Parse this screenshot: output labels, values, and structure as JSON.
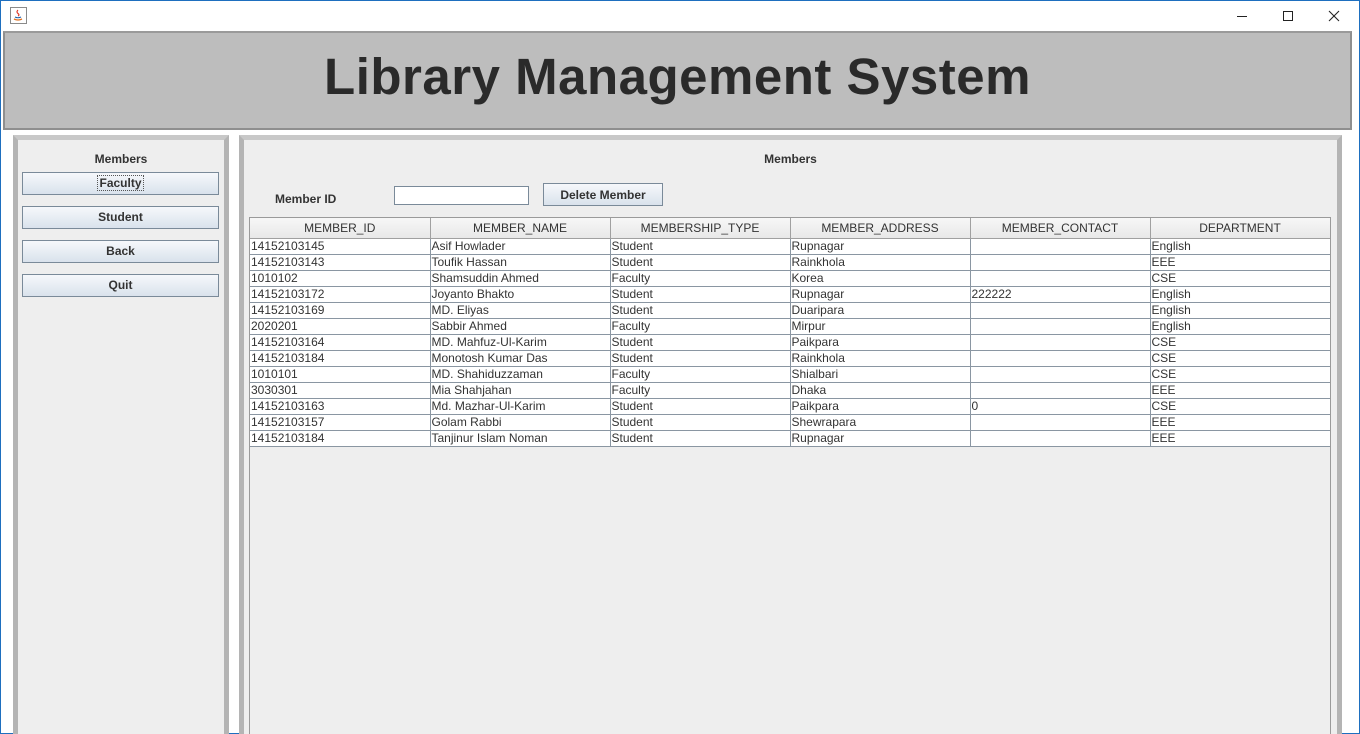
{
  "window": {
    "controls": {
      "minimize": "minimize-icon",
      "maximize": "maximize-icon",
      "close": "close-icon"
    },
    "app_icon": "java-icon"
  },
  "header": {
    "title": "Library Management System"
  },
  "left_panel": {
    "title": "Members",
    "buttons": [
      "Faculty",
      "Student",
      "Back",
      "Quit"
    ]
  },
  "main_panel": {
    "title": "Members",
    "member_id_label": "Member ID",
    "member_id_value": "",
    "delete_button": "Delete Member",
    "table": {
      "columns": [
        "MEMBER_ID",
        "MEMBER_NAME",
        "MEMBERSHIP_TYPE",
        "MEMBER_ADDRESS",
        "MEMBER_CONTACT",
        "DEPARTMENT"
      ],
      "rows": [
        [
          "14152103145",
          "Asif Howlader",
          "Student",
          "Rupnagar",
          "",
          "English"
        ],
        [
          "14152103143",
          "Toufik Hassan",
          "Student",
          "Rainkhola",
          "",
          "EEE"
        ],
        [
          "1010102",
          "Shamsuddin Ahmed",
          "Faculty",
          "Korea",
          "",
          "CSE"
        ],
        [
          "14152103172",
          "Joyanto Bhakto",
          "Student",
          "Rupnagar",
          "222222",
          "English"
        ],
        [
          "14152103169",
          "MD. Eliyas",
          "Student",
          "Duaripara",
          "",
          "English"
        ],
        [
          "2020201",
          "Sabbir Ahmed",
          "Faculty",
          "Mirpur",
          "",
          "English"
        ],
        [
          "14152103164",
          "MD. Mahfuz-Ul-Karim",
          "Student",
          "Paikpara",
          "",
          "CSE"
        ],
        [
          "14152103184",
          "Monotosh Kumar Das",
          "Student",
          "Rainkhola",
          "",
          "CSE"
        ],
        [
          "1010101",
          "MD. Shahiduzzaman",
          "Faculty",
          "Shialbari",
          "",
          "CSE"
        ],
        [
          "3030301",
          "Mia Shahjahan",
          "Faculty",
          "Dhaka",
          "",
          "EEE"
        ],
        [
          "14152103163",
          "Md. Mazhar-Ul-Karim",
          "Student",
          "Paikpara",
          "0",
          "CSE"
        ],
        [
          "14152103157",
          "Golam Rabbi",
          "Student",
          "Shewrapara",
          "",
          "EEE"
        ],
        [
          "14152103184",
          "Tanjinur Islam Noman",
          "Student",
          "Rupnagar",
          "",
          "EEE"
        ]
      ]
    }
  },
  "colors": {
    "header_bg": "#bdbdbd",
    "panel_bg": "#eeeeee",
    "window_border": "#1e6fbf"
  }
}
